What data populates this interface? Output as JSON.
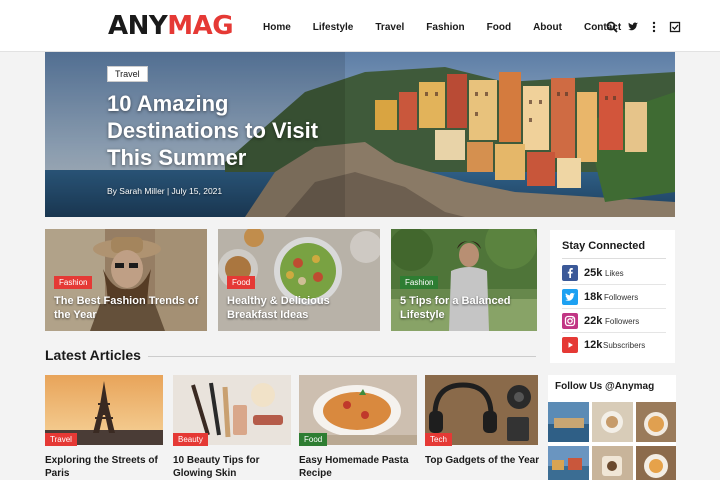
{
  "brand": {
    "part1": "ANY",
    "part2": "MAG"
  },
  "nav": {
    "items": [
      "Home",
      "Lifestyle",
      "Travel",
      "Fashion",
      "Food",
      "About",
      "Contact"
    ]
  },
  "icons": [
    "search-icon",
    "twitter-icon",
    "more-icon",
    "checkbox-icon"
  ],
  "hero": {
    "tag": "Travel",
    "title": "10 Amazing Destinations to Visit This Summer",
    "meta": "By Sarah Miller  |  July 15, 2021"
  },
  "cards": [
    {
      "tag": "Fashion",
      "title": "The Best Fashion Trends of the Year"
    },
    {
      "tag": "Food",
      "title": "Healthy & Delicious Breakfast Ideas"
    },
    {
      "tag": "Fashion",
      "title": "5 Tips for a Balanced Lifestyle"
    }
  ],
  "stay_connected": {
    "title": "Stay Connected",
    "items": [
      {
        "icon": "facebook-icon",
        "count": "25k",
        "label": "Likes"
      },
      {
        "icon": "twitter-icon",
        "count": "18k",
        "label": "Followers"
      },
      {
        "icon": "instagram-icon",
        "count": "22k",
        "label": "Followers"
      },
      {
        "icon": "youtube-icon",
        "count": "12k",
        "label": "Subscribers"
      }
    ]
  },
  "latest": {
    "title": "Latest Articles",
    "articles": [
      {
        "tag": "Travel",
        "title": "Exploring the Streets of Paris"
      },
      {
        "tag": "Beauty",
        "title": "10 Beauty Tips for Glowing Skin"
      },
      {
        "tag": "Food",
        "title": "Easy Homemade Pasta Recipe"
      },
      {
        "tag": "Tech",
        "title": "Top Gadgets of the Year"
      }
    ]
  },
  "follow": {
    "title": "Follow Us @Anymag"
  },
  "colors": {
    "accent": "#e53935",
    "food": "#2e7d32",
    "fashion": "#e53935",
    "beauty": "#e53935",
    "tech": "#e53935",
    "travel": "#e53935"
  }
}
